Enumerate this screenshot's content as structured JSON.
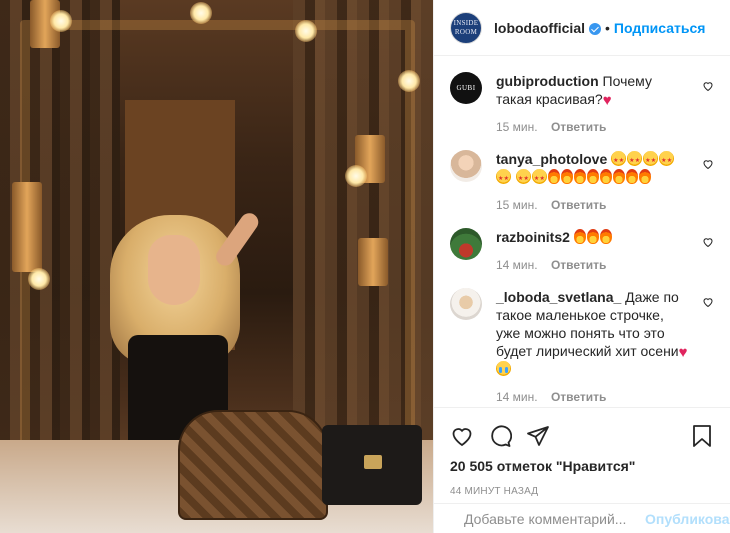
{
  "header": {
    "avatar_text_line1": "INSIDE",
    "avatar_text_line2": "ROOM",
    "username": "lobodaofficial",
    "separator": "•",
    "follow_label": "Подписаться"
  },
  "comments": [
    {
      "author": "gubiproduction",
      "text": "Почему такая красивая?",
      "emoji": [
        "heart-red"
      ],
      "avatar_label": "GUBI",
      "time": "15 мин.",
      "reply": "Ответить"
    },
    {
      "author": "tanya_photolove",
      "text": "",
      "emoji": [
        "star-struck",
        "star-struck",
        "star-struck",
        "star-struck",
        "star-struck",
        "star-struck",
        "star-struck",
        "fire",
        "fire",
        "fire",
        "fire",
        "fire",
        "fire",
        "fire",
        "fire"
      ],
      "time": "15 мин.",
      "reply": "Ответить"
    },
    {
      "author": "razboinits2",
      "text": "",
      "emoji": [
        "fire",
        "fire",
        "fire"
      ],
      "time": "14 мин.",
      "reply": "Ответить"
    },
    {
      "author": "_loboda_svetlana_",
      "text": "Даже по такое маленькое строчке, уже можно понять что это будет лирический хит осени",
      "emoji": [
        "heart-red",
        "crying-face"
      ],
      "time": "14 мин.",
      "reply": "Ответить"
    }
  ],
  "actions": {
    "likes": "20 505 отметок \"Нравится\"",
    "posted": "44 минут назад"
  },
  "add_comment": {
    "placeholder": "Добавьте комментарий...",
    "post_label": "Опубликовать"
  },
  "colors": {
    "accent": "#0095f6",
    "verified": "#3897f0",
    "muted": "#8e8e8e",
    "post_disabled": "#b2dffc"
  }
}
